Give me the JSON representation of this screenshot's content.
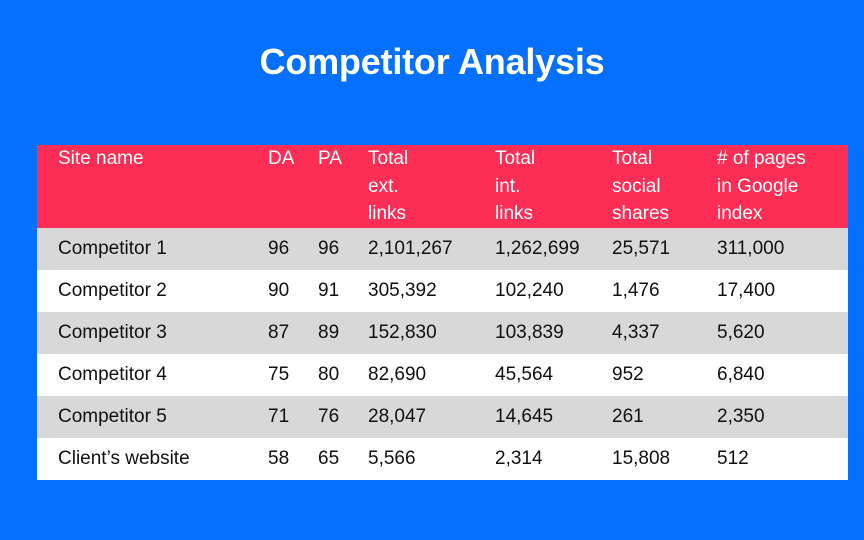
{
  "slide": {
    "title": "Competitor Analysis",
    "background_color": "#0570fd",
    "header_color": "#fc2e55",
    "stripe_color": "#d8d8d8",
    "row_color": "#ffffff",
    "title_color": "#ffffff",
    "text_color": "#101010"
  },
  "table": {
    "headers": [
      "Site name",
      "DA",
      "PA",
      "Total ext. links",
      "Total int. links",
      "Total social shares",
      "# of pages in Google index"
    ],
    "header_lines": [
      [
        "Site name"
      ],
      [
        "DA"
      ],
      [
        "PA"
      ],
      [
        "Total",
        "ext.",
        "links"
      ],
      [
        "Total",
        "int.",
        "links"
      ],
      [
        "Total",
        "social",
        "shares"
      ],
      [
        "# of pages",
        "in Google",
        "index"
      ]
    ],
    "rows": [
      {
        "site": "Competitor 1",
        "da": "96",
        "pa": "96",
        "ext_links": "2,101,267",
        "int_links": "1,262,699",
        "social_shares": "25,571",
        "google_index": "311,000"
      },
      {
        "site": "Competitor 2",
        "da": "90",
        "pa": "91",
        "ext_links": "305,392",
        "int_links": "102,240",
        "social_shares": "1,476",
        "google_index": "17,400"
      },
      {
        "site": "Competitor 3",
        "da": "87",
        "pa": "89",
        "ext_links": "152,830",
        "int_links": "103,839",
        "social_shares": "4,337",
        "google_index": "5,620"
      },
      {
        "site": "Competitor 4",
        "da": "75",
        "pa": "80",
        "ext_links": "82,690",
        "int_links": "45,564",
        "social_shares": "952",
        "google_index": "6,840"
      },
      {
        "site": "Competitor 5",
        "da": "71",
        "pa": "76",
        "ext_links": "28,047",
        "int_links": "14,645",
        "social_shares": "261",
        "google_index": "2,350"
      },
      {
        "site": "Client’s website",
        "da": "58",
        "pa": "65",
        "ext_links": "5,566",
        "int_links": "2,314",
        "social_shares": "15,808",
        "google_index": "512"
      }
    ]
  }
}
